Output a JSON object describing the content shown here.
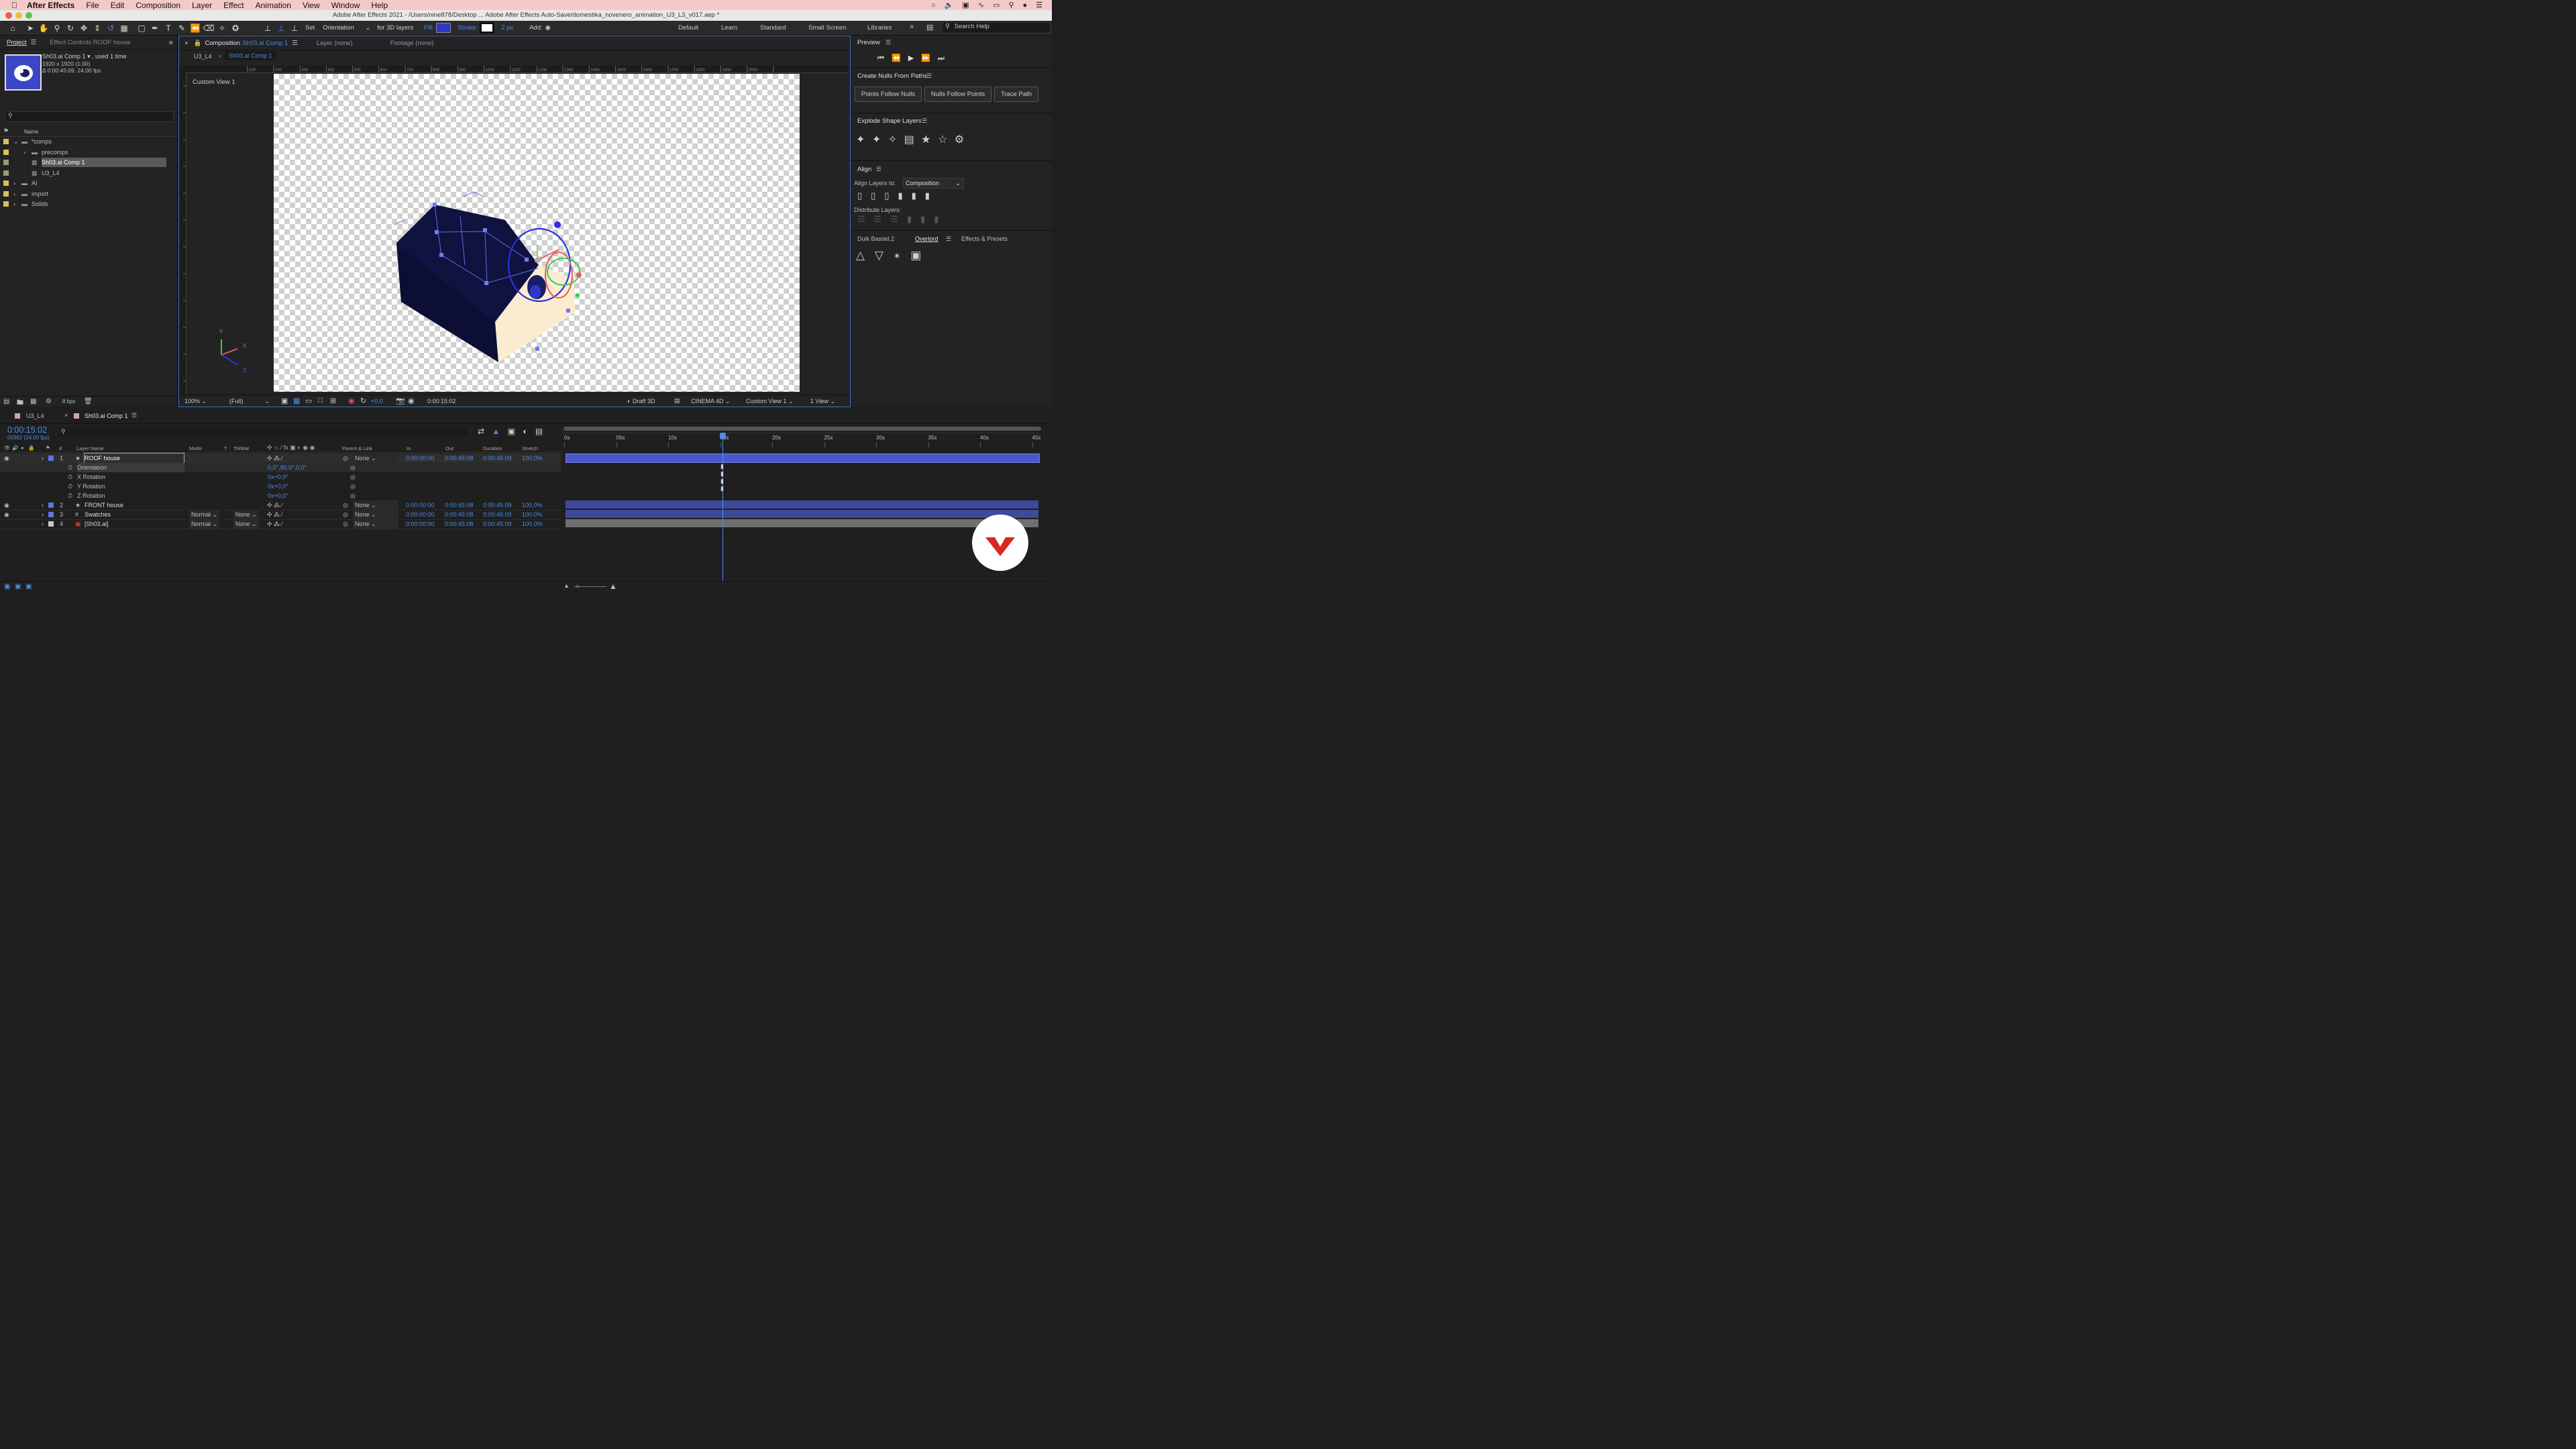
{
  "menubar": {
    "app": "After Effects",
    "items": [
      "File",
      "Edit",
      "Composition",
      "Layer",
      "Effect",
      "Animation",
      "View",
      "Window",
      "Help"
    ]
  },
  "titlebar": {
    "title": "Adobe After Effects 2021 - /Users/nine878/Desktop ... Adobe After Effects Auto-Save/domestika_novenero_animation_U3_L3_v017.aep *"
  },
  "toolbar": {
    "set_label": "Set",
    "orientation_value": "Orientation",
    "for3d_label": "for 3D layers",
    "fill_label": "Fill:",
    "stroke_label": "Stroke:",
    "stroke_width": "2 px",
    "add_label": "Add:",
    "workspaces": [
      "Default",
      "Learn",
      "Standard",
      "Small Screen",
      "Libraries"
    ],
    "search_placeholder": "Search Help",
    "fill_color": "#2f37c8"
  },
  "project": {
    "tab": "Project",
    "effect_controls_tab": "Effect Controls ROOF house",
    "item_name": "Sh03.ai Comp 1 ▾ , used 1 time",
    "item_size": "1920 x 1920 (1,00)",
    "item_duration": "Δ 0:00:45:09, 24,00 fps",
    "name_header": "Name",
    "tree": [
      {
        "label": "*comps",
        "indent": 0,
        "expanded": true,
        "type": "folder"
      },
      {
        "label": "precomps",
        "indent": 1,
        "expanded": false,
        "type": "folder"
      },
      {
        "label": "Sh03.ai Comp 1",
        "indent": 1,
        "type": "comp",
        "selected": true
      },
      {
        "label": "U3_L4",
        "indent": 1,
        "type": "comp"
      },
      {
        "label": "AI",
        "indent": 0,
        "expanded": false,
        "type": "folder"
      },
      {
        "label": "import",
        "indent": 0,
        "expanded": false,
        "type": "folder"
      },
      {
        "label": "Solids",
        "indent": 0,
        "expanded": false,
        "type": "folder"
      }
    ],
    "bpc": "8 bpc"
  },
  "composition": {
    "tab_label": "Composition",
    "comp_name": "Sh03.ai Comp 1",
    "layer_tab": "Layer (none)",
    "footage_tab": "Footage (none)",
    "breadcrumbs": [
      "U3_L4",
      "Sh03.ai Comp 1"
    ],
    "view_label": "Custom View 1",
    "ruler_labels": [
      "100",
      "200",
      "300",
      "400",
      "500",
      "600",
      "700",
      "800",
      "900",
      "1000",
      "1100",
      "1200",
      "1300",
      "1400",
      "1500",
      "1600",
      "1700",
      "1800",
      "1900",
      "2000"
    ],
    "zoom": "100%",
    "resolution": "(Full)",
    "exposure": "+0,0",
    "timecode": "0:00:15:02",
    "draft3d": "Draft 3D",
    "renderer": "CINEMA 4D",
    "camera_view": "Custom View 1",
    "views": "1 View"
  },
  "preview": {
    "title": "Preview"
  },
  "nulls": {
    "title": "Create Nulls From Paths",
    "buttons": [
      "Points Follow Nulls",
      "Nulls Follow Points",
      "Trace Path"
    ]
  },
  "explode": {
    "title": "Explode Shape Layers"
  },
  "align": {
    "title": "Align",
    "align_to_label": "Align Layers to:",
    "align_to_value": "Composition",
    "distribute_label": "Distribute Layers:"
  },
  "extra_tabs": [
    "Duik Bassel.2",
    "Overlord",
    "Effects & Presets"
  ],
  "timeline": {
    "tabs": [
      "U3_L4",
      "Sh03.ai Comp 1"
    ],
    "timecode": "0:00:15:02",
    "frame_info": "00362 (24.00 fps)",
    "columns": {
      "num": "#",
      "layer_name": "Layer Name",
      "mode": "Mode",
      "t": "T",
      "trkmat": "TrkMat",
      "parent": "Parent & Link",
      "in": "In",
      "out": "Out",
      "duration": "Duration",
      "stretch": "Stretch"
    },
    "ticks": [
      "0s",
      "05s",
      "10s",
      "15s",
      "20s",
      "25s",
      "30s",
      "35s",
      "40s",
      "45s"
    ],
    "layers": [
      {
        "num": "1",
        "name": "ROOF house",
        "color": "#5a78d8",
        "mode": "",
        "trkmat": "",
        "parent": "None",
        "in": "0:00:00:00",
        "out": "0:00:45:08",
        "duration": "0:00:45:09",
        "stretch": "100,0%",
        "selected": true
      },
      {
        "num": "2",
        "name": "FRONT house",
        "color": "#5a78d8",
        "mode": "",
        "trkmat": "",
        "parent": "None",
        "in": "0:00:00:00",
        "out": "0:00:45:08",
        "duration": "0:00:45:09",
        "stretch": "100,0%"
      },
      {
        "num": "3",
        "name": "Swatches",
        "color": "#5a78d8",
        "mode": "Normal",
        "trkmat": "None",
        "parent": "None",
        "in": "0:00:00:00",
        "out": "0:00:45:08",
        "duration": "0:00:45:09",
        "stretch": "100,0%"
      },
      {
        "num": "4",
        "name": "[Sh03.ai]",
        "color": "#c8c8c8",
        "mode": "Normal",
        "trkmat": "None",
        "parent": "None",
        "in": "0:00:00:00",
        "out": "0:00:45:08",
        "duration": "0:00:45:09",
        "stretch": "100,0%"
      }
    ],
    "properties": [
      {
        "name": "Orientation",
        "value": "0,0°,90,0°,0,0°"
      },
      {
        "name": "X Rotation",
        "value": "0x+0,0°"
      },
      {
        "name": "Y Rotation",
        "value": "0x+0,0°"
      },
      {
        "name": "Z Rotation",
        "value": "0x+0,0°"
      }
    ]
  },
  "axes": {
    "x": "X",
    "y": "Y",
    "z": "Z"
  }
}
